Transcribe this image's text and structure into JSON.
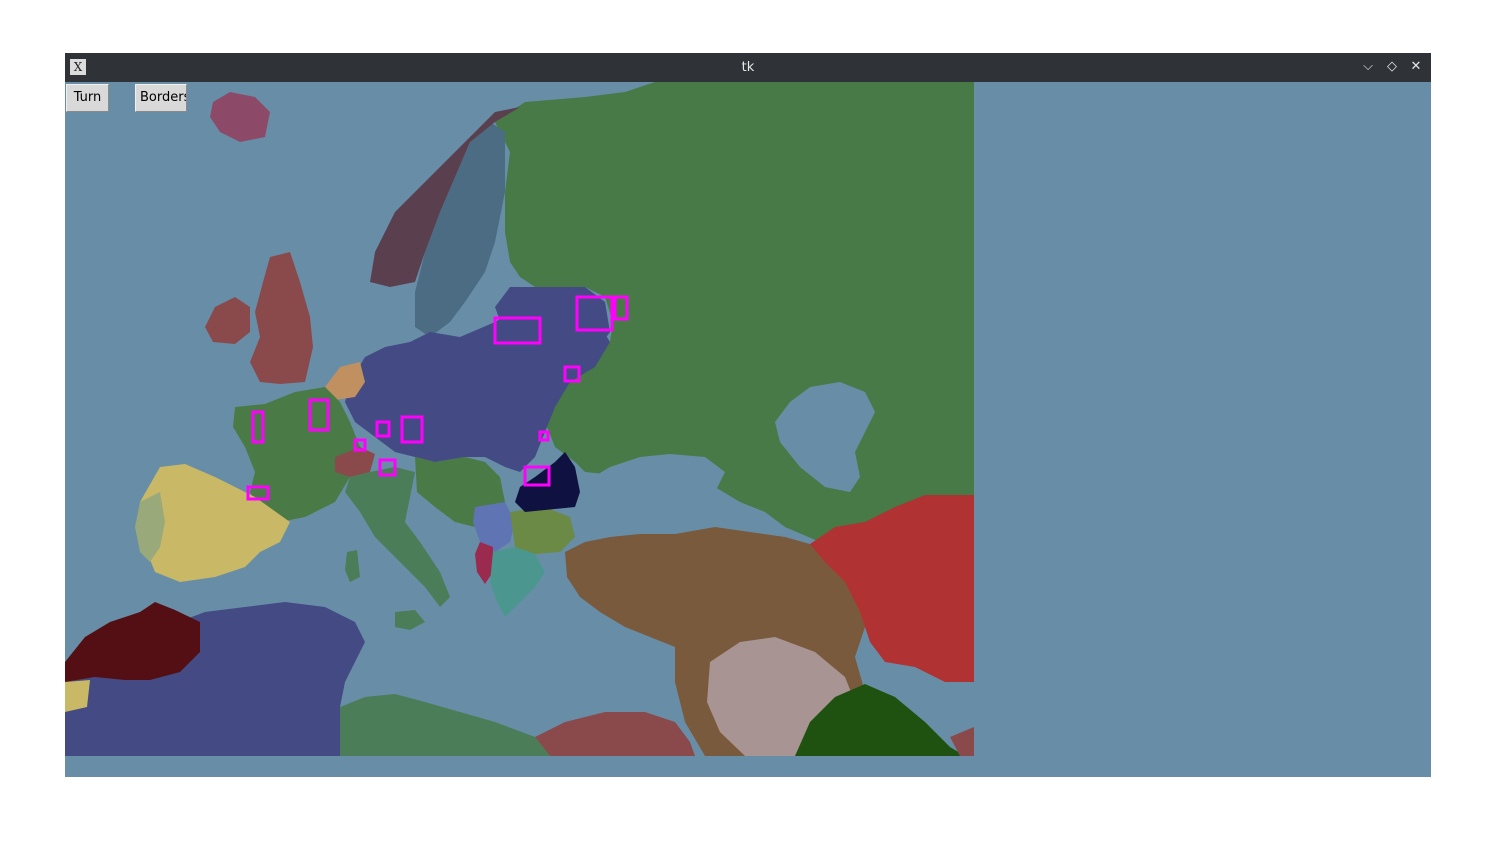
{
  "window": {
    "title": "tk"
  },
  "titlebar": {
    "app_icon": "x-window-icon",
    "minimize_glyph": "⌵",
    "maximize_glyph": "◇",
    "close_glyph": "✕"
  },
  "toolbar": {
    "turn_label": "Turn",
    "borders_label": "Borders"
  },
  "map": {
    "sea_color": "#688ea7",
    "highlight_color": "#ff00ff",
    "regions": [
      {
        "name": "russia",
        "color": "#477a46"
      },
      {
        "name": "scandinavia-sweden",
        "color": "#4b6c82"
      },
      {
        "name": "norway",
        "color": "#5a3f4f"
      },
      {
        "name": "iceland",
        "color": "#8c4a68"
      },
      {
        "name": "britain",
        "color": "#8a4a4c"
      },
      {
        "name": "france",
        "color": "#4a7a46"
      },
      {
        "name": "germany",
        "color": "#444a84"
      },
      {
        "name": "iberia",
        "color": "#c9b866"
      },
      {
        "name": "portugal",
        "color": "#9aa97a"
      },
      {
        "name": "italy",
        "color": "#4b7d58"
      },
      {
        "name": "balkans-serbia",
        "color": "#5f74b2"
      },
      {
        "name": "bulgaria",
        "color": "#6b8a45"
      },
      {
        "name": "romania",
        "color": "#0f1240"
      },
      {
        "name": "greece",
        "color": "#4c9690"
      },
      {
        "name": "albania",
        "color": "#9a2a4e"
      },
      {
        "name": "ottoman",
        "color": "#7a5a3c"
      },
      {
        "name": "persia",
        "color": "#b03233"
      },
      {
        "name": "arabia",
        "color": "#a89492"
      },
      {
        "name": "gulf-region",
        "color": "#1f5211"
      },
      {
        "name": "morocco",
        "color": "#540f14"
      },
      {
        "name": "north-africa",
        "color": "#444a84"
      },
      {
        "name": "libya",
        "color": "#4b7d58"
      },
      {
        "name": "egypt",
        "color": "#8a4a4c"
      }
    ]
  }
}
